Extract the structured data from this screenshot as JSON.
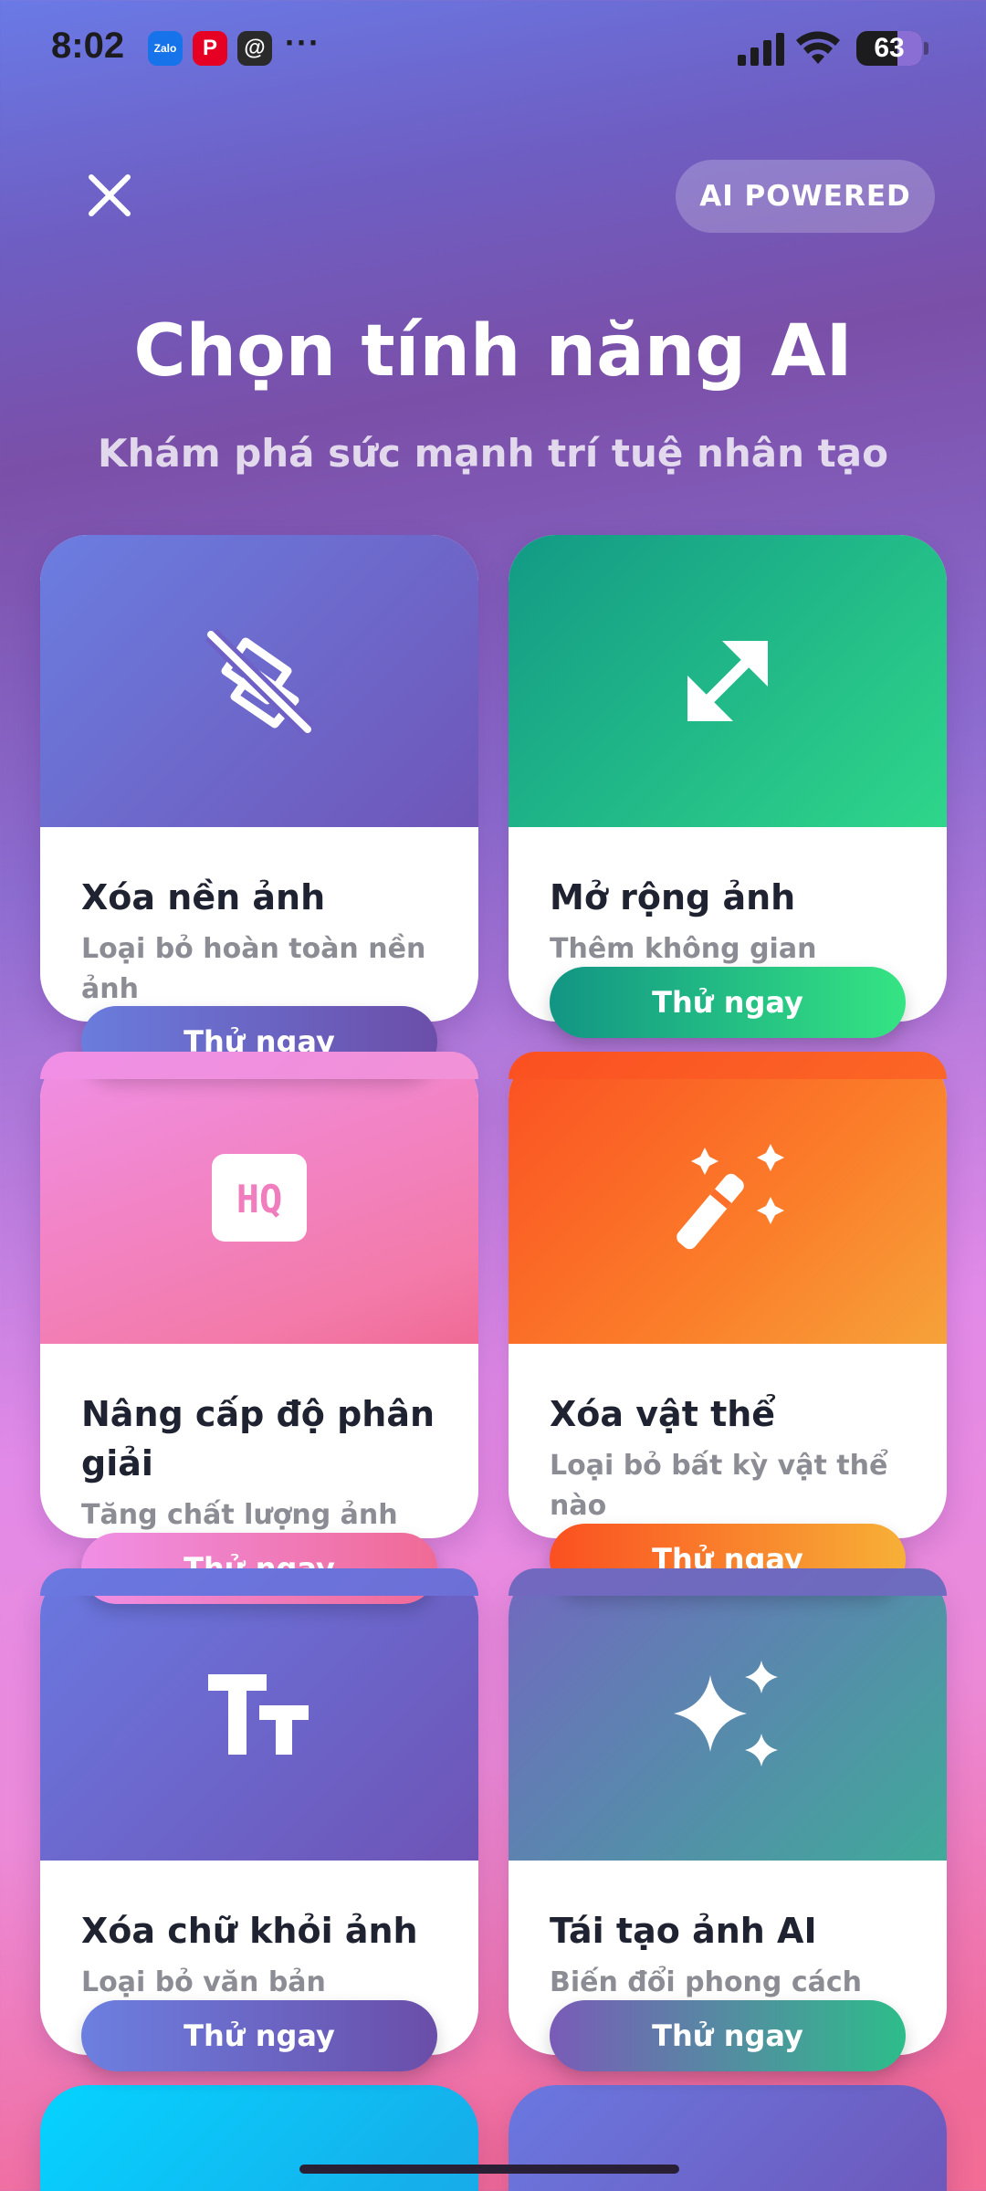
{
  "status_bar": {
    "time": "8:02",
    "apps": [
      {
        "name": "zalo",
        "label": "Zalo"
      },
      {
        "name": "pinterest",
        "label": "P"
      },
      {
        "name": "threads",
        "label": "@"
      }
    ],
    "more": "···",
    "battery": "63"
  },
  "header": {
    "badge": "AI POWERED",
    "title": "Chọn tính năng AI",
    "subtitle": "Khám phá sức mạnh trí tuệ nhân tạo"
  },
  "cards": [
    {
      "title": "Xóa nền ảnh",
      "desc": "Loại bỏ hoàn toàn nền ảnh",
      "button": "Thử ngay",
      "icon": "remove-background-icon"
    },
    {
      "title": "Mở rộng ảnh",
      "desc": "Thêm không gian",
      "button": "Thử ngay",
      "icon": "expand-arrows-icon"
    },
    {
      "title": "Nâng cấp độ phân giải",
      "desc": "Tăng chất lượng ảnh",
      "button": "Thử ngay",
      "icon": "hq-icon"
    },
    {
      "title": "Xóa vật thể",
      "desc": "Loại bỏ bất kỳ vật thể nào",
      "button": "Thử ngay",
      "icon": "magic-wand-icon"
    },
    {
      "title": "Xóa chữ khỏi ảnh",
      "desc": "Loại bỏ văn bản",
      "button": "Thử ngay",
      "icon": "text-size-icon"
    },
    {
      "title": "Tái tạo ảnh AI",
      "desc": "Biến đổi phong cách",
      "button": "Thử ngay",
      "icon": "sparkles-icon"
    }
  ],
  "colors": {
    "purple": "#6b7de0",
    "green": "#2fd68a",
    "pink": "#f08fe6",
    "orange": "#fb5022",
    "teal": "#3faa99",
    "cyan": "#05d3ff"
  }
}
